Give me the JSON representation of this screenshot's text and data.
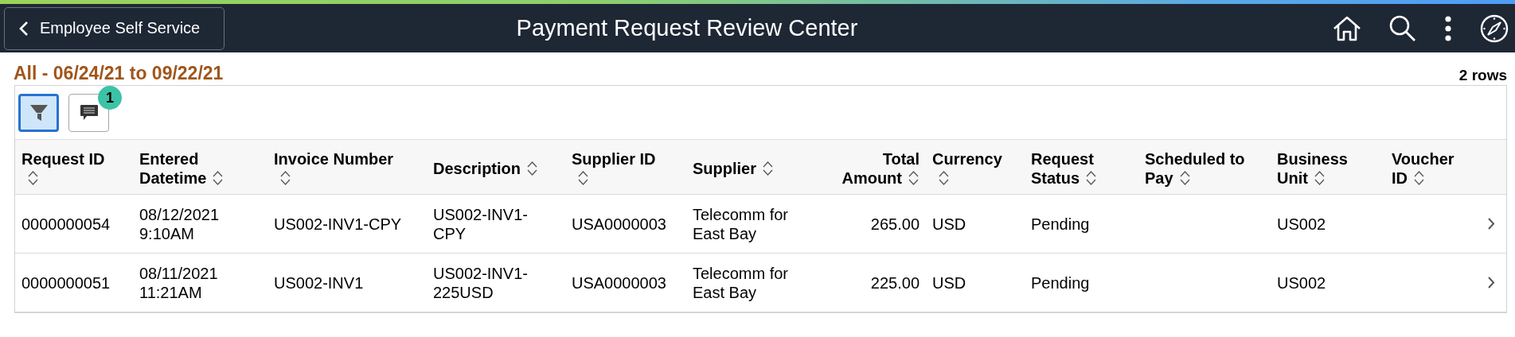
{
  "header": {
    "back_button": "Employee Self Service",
    "title": "Payment Request Review Center"
  },
  "range_title": "All - 06/24/21 to 09/22/21",
  "row_count": "2 rows",
  "toolbar": [
    {
      "kind": "filter",
      "selected": true
    },
    {
      "kind": "comment",
      "selected": false,
      "badge": "1"
    }
  ],
  "table": {
    "columns": [
      "Request ID",
      "Entered Datetime",
      "Invoice Number",
      "Description",
      "Supplier ID",
      "Supplier",
      "Total Amount",
      "Currency",
      "Request Status",
      "Scheduled to Pay",
      "Business Unit",
      "Voucher ID"
    ],
    "rows": [
      {
        "request_id": "0000000054",
        "entered_datetime": "08/12/2021 9:10AM",
        "invoice_number": "US002-INV1-CPY",
        "description": "US002-INV1-CPY",
        "supplier_id": "USA0000003",
        "supplier": "Telecomm for East Bay",
        "total_amount": "265.00",
        "currency": "USD",
        "request_status": "Pending",
        "business_unit": "US002"
      },
      {
        "request_id": "0000000051",
        "entered_datetime": "08/11/2021 11:21AM",
        "invoice_number": "US002-INV1",
        "description": "US002-INV1-225USD",
        "supplier_id": "USA0000003",
        "supplier": "Telecomm for East Bay",
        "total_amount": "225.00",
        "currency": "USD",
        "request_status": "Pending",
        "business_unit": "US002"
      }
    ]
  }
}
